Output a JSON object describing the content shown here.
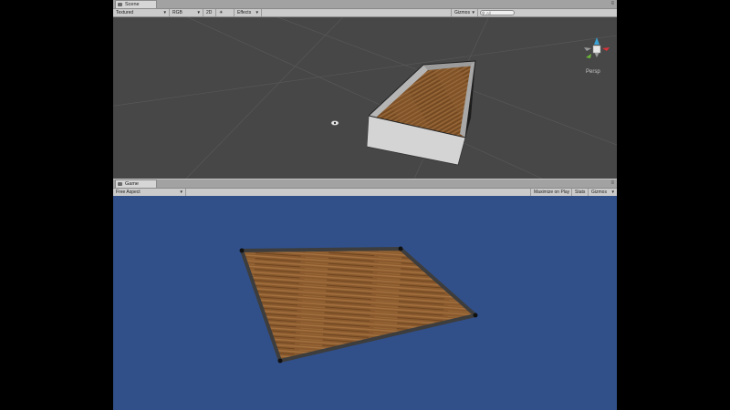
{
  "scene": {
    "tab_label": "Scene",
    "toolbar": {
      "shading_mode": "Textured",
      "render_mode": "RGB",
      "view_mode": "2D",
      "effects_label": "Effects",
      "gizmos_label": "Gizmos",
      "search_placeholder": "All"
    },
    "projection_label": "Persp"
  },
  "game": {
    "tab_label": "Game",
    "toolbar": {
      "aspect": "Free Aspect",
      "maximize_label": "Maximize on Play",
      "stats_label": "Stats",
      "gizmos_label": "Gizmos"
    }
  },
  "icons": {
    "scene_tab": "scene-icon",
    "game_tab": "game-icon",
    "camera_eye": "eye-icon",
    "orientation": "axis-gizmo-icon"
  },
  "colors": {
    "scene_background": "#474747",
    "game_background": "#31508a",
    "wood": "#8a5a2e",
    "panel_gray": "#c2c2c2"
  }
}
